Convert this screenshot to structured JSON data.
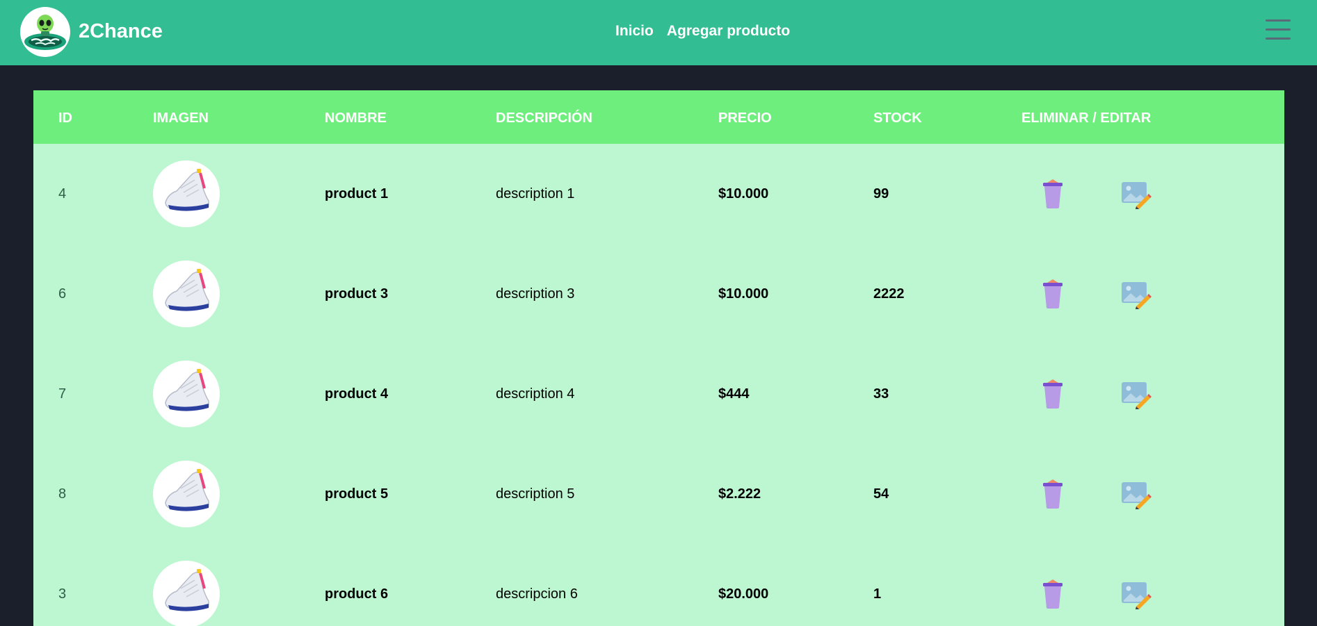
{
  "navbar": {
    "brand": "2Chance",
    "links": [
      {
        "label": "Inicio"
      },
      {
        "label": "Agregar producto"
      }
    ]
  },
  "table": {
    "headers": {
      "id": "ID",
      "image": "IMAGEN",
      "name": "NOMBRE",
      "description": "DESCRIPCIÓN",
      "price": "PRECIO",
      "stock": "STOCK",
      "actions": "ELIMINAR / EDITAR"
    },
    "rows": [
      {
        "id": "4",
        "name": "product 1",
        "description": "description 1",
        "price": "$10.000",
        "stock": "99"
      },
      {
        "id": "6",
        "name": "product 3",
        "description": "description 3",
        "price": "$10.000",
        "stock": "2222"
      },
      {
        "id": "7",
        "name": "product 4",
        "description": "description 4",
        "price": "$444",
        "stock": "33"
      },
      {
        "id": "8",
        "name": "product 5",
        "description": "description 5",
        "price": "$2.222",
        "stock": "54"
      },
      {
        "id": "3",
        "name": "product 6",
        "description": "descripcion 6",
        "price": "$20.000",
        "stock": "1"
      }
    ]
  },
  "colors": {
    "navbar": "#33bd92",
    "page_background": "#1b1f2b",
    "table_header": "#6eee7c",
    "table_body": "#bcf7d1",
    "delete_icon": "#b89be6",
    "edit_icon": "#8fbcd8"
  },
  "icons": {
    "delete": "trash-icon",
    "edit": "edit-image-icon",
    "menu": "hamburger-menu-icon"
  }
}
